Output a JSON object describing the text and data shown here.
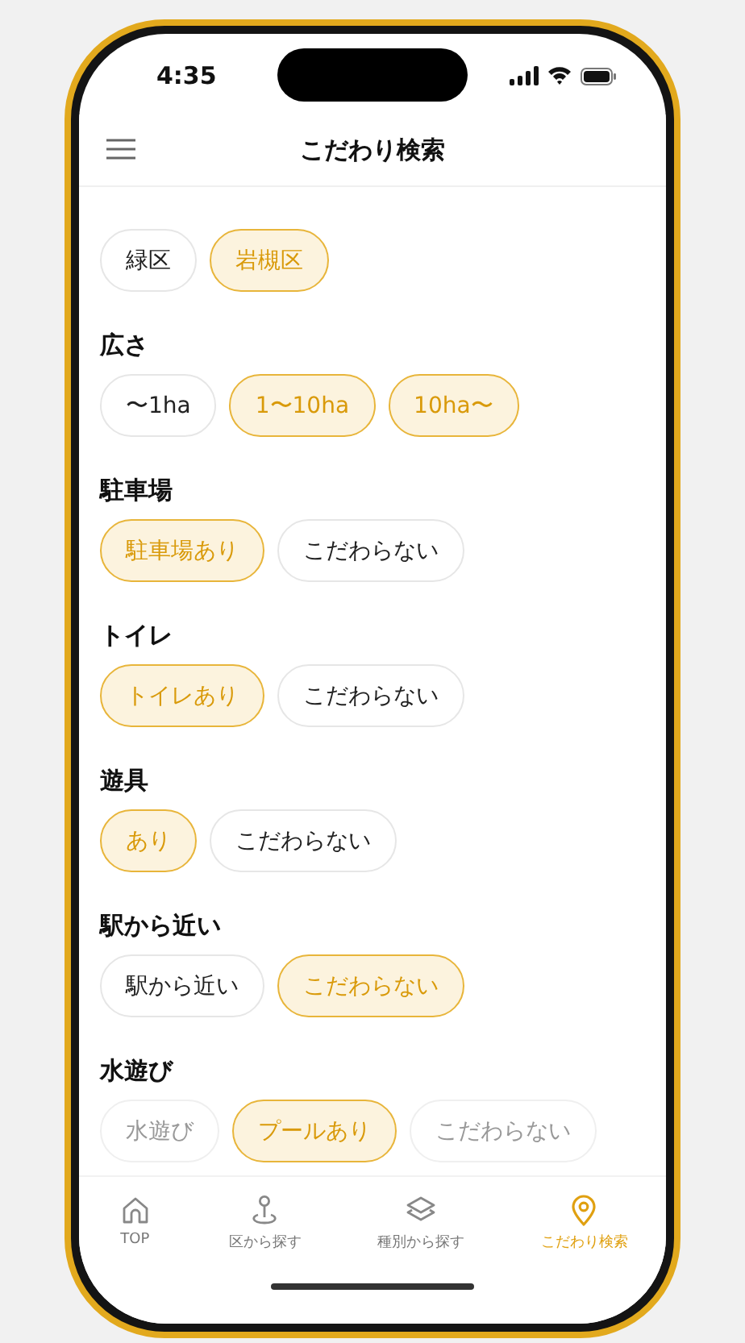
{
  "status_bar": {
    "time": "4:35"
  },
  "header": {
    "title": "こだわり検索"
  },
  "sections": [
    {
      "options": [
        {
          "label": "緑区",
          "selected": false
        },
        {
          "label": "岩槻区",
          "selected": true
        }
      ]
    },
    {
      "title": "広さ",
      "options": [
        {
          "label": "〜1ha",
          "selected": false
        },
        {
          "label": "1〜10ha",
          "selected": true
        },
        {
          "label": "10ha〜",
          "selected": true
        }
      ]
    },
    {
      "title": "駐車場",
      "options": [
        {
          "label": "駐車場あり",
          "selected": true
        },
        {
          "label": "こだわらない",
          "selected": false
        }
      ]
    },
    {
      "title": "トイレ",
      "options": [
        {
          "label": "トイレあり",
          "selected": true
        },
        {
          "label": "こだわらない",
          "selected": false
        }
      ]
    },
    {
      "title": "遊具",
      "options": [
        {
          "label": "あり",
          "selected": true
        },
        {
          "label": "こだわらない",
          "selected": false
        }
      ]
    },
    {
      "title": "駅から近い",
      "options": [
        {
          "label": "駅から近い",
          "selected": false
        },
        {
          "label": "こだわらない",
          "selected": true
        }
      ]
    },
    {
      "title": "水遊び",
      "options": [
        {
          "label": "水遊び",
          "selected": false,
          "disabled": true
        },
        {
          "label": "プールあり",
          "selected": true,
          "disabled": false
        },
        {
          "label": "こだわらない",
          "selected": false,
          "disabled": true
        }
      ]
    }
  ],
  "tab_bar": [
    {
      "kind": "home",
      "label": "TOP",
      "selected": false
    },
    {
      "kind": "pin",
      "label": "区から探す",
      "selected": false
    },
    {
      "kind": "layers",
      "label": "種別から探す",
      "selected": false
    },
    {
      "kind": "location",
      "label": "こだわり検索",
      "selected": true
    }
  ]
}
